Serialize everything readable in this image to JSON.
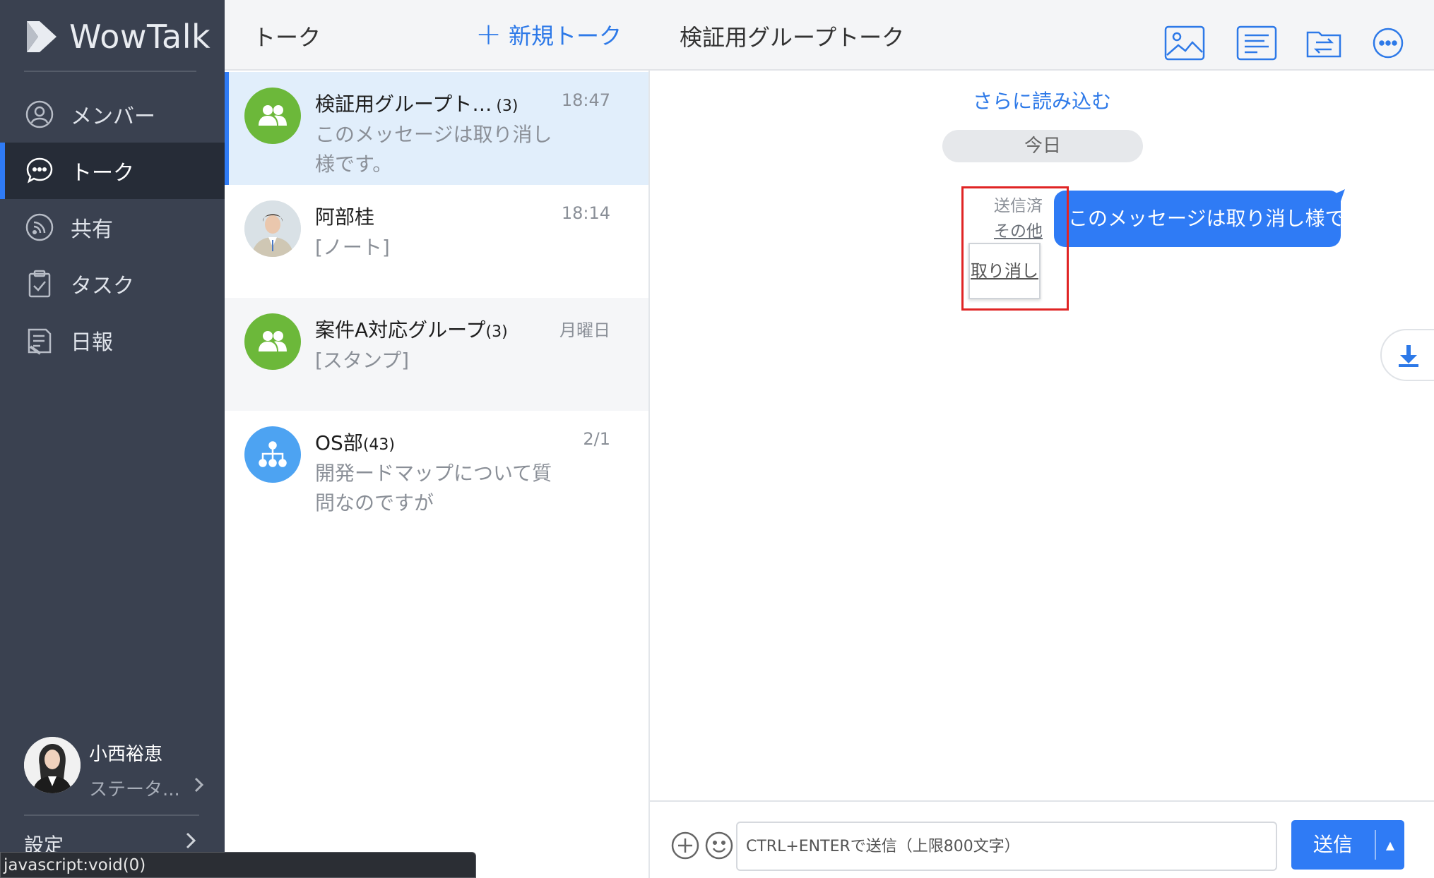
{
  "app": {
    "brand": "WowTalk"
  },
  "sidebar": {
    "items": [
      {
        "label": "メンバー",
        "icon": "member-icon"
      },
      {
        "label": "トーク",
        "icon": "chat-bubble-icon",
        "active": true
      },
      {
        "label": "共有",
        "icon": "share-icon"
      },
      {
        "label": "タスク",
        "icon": "clipboard-check-icon"
      },
      {
        "label": "日報",
        "icon": "report-icon"
      }
    ],
    "user": {
      "name": "小西裕恵",
      "status": "ステータ..."
    },
    "settings_label": "設定"
  },
  "statusbar": {
    "text": "javascript:void(0)"
  },
  "talklist": {
    "title": "トーク",
    "new_talk_label": "新規トーク",
    "items": [
      {
        "name": "検証用グループト…",
        "count": "(3)",
        "time": "18:47",
        "preview": "このメッセージは取り消し様です。",
        "avatar": "group-icon",
        "selected": true
      },
      {
        "name": "阿部桂",
        "count": "",
        "time": "18:14",
        "preview": "[ノート]",
        "avatar": "photo"
      },
      {
        "name": "案件A対応グループ",
        "count": "(3)",
        "time": "月曜日",
        "preview": "[スタンプ]",
        "avatar": "group-icon"
      },
      {
        "name": "OS部",
        "count": "(43)",
        "time": "2/1",
        "preview": "開発ードマップについて質問なのですが",
        "avatar": "org-chart-icon"
      }
    ]
  },
  "chat": {
    "title": "検証用グループトーク",
    "header_icons": [
      "image-icon",
      "notes-icon",
      "file-transfer-icon",
      "more-icon"
    ],
    "load_more": "さらに読み込む",
    "date_label": "今日",
    "message": {
      "status": "送信済",
      "other_link": "その他",
      "text": "このメッセージは取り消し様です。",
      "popup_action": "取り消し"
    },
    "composer": {
      "placeholder": "CTRL+ENTERで送信（上限800文字）",
      "send_label": "送信"
    }
  },
  "colors": {
    "sidebar_bg": "#3a4150",
    "sidebar_active": "#262c37",
    "accent": "#2f7bf5",
    "group_green": "#6cb83a",
    "org_blue": "#4da3f2",
    "highlight_red": "#e02424"
  }
}
